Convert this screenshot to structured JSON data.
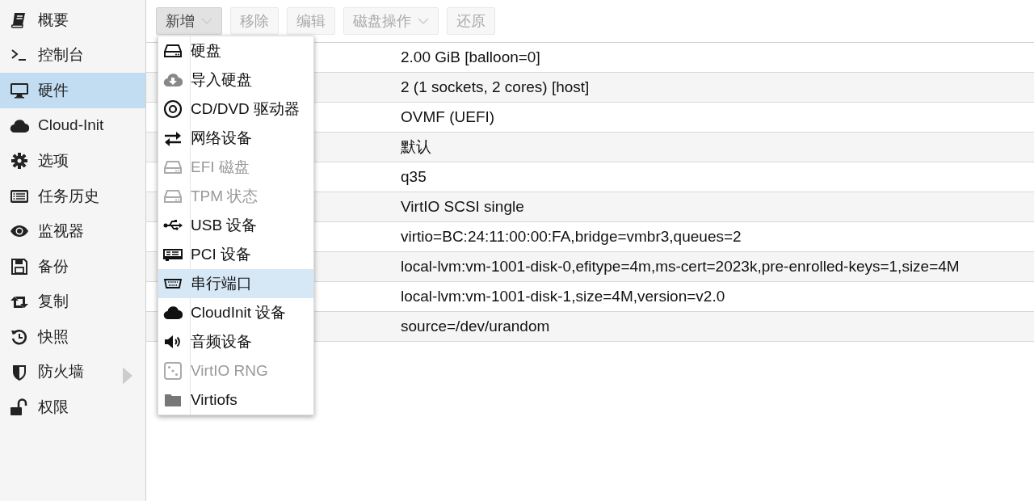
{
  "sidebar": {
    "items": [
      {
        "label": "概要",
        "kind": "book",
        "selected": false,
        "has_submenu": false
      },
      {
        "label": "控制台",
        "kind": "terminal",
        "selected": false,
        "has_submenu": false
      },
      {
        "label": "硬件",
        "kind": "monitor",
        "selected": true,
        "has_submenu": false
      },
      {
        "label": "Cloud-Init",
        "kind": "cloud",
        "selected": false,
        "has_submenu": false
      },
      {
        "label": "选项",
        "kind": "gear",
        "selected": false,
        "has_submenu": false
      },
      {
        "label": "任务历史",
        "kind": "list",
        "selected": false,
        "has_submenu": false
      },
      {
        "label": "监视器",
        "kind": "eye",
        "selected": false,
        "has_submenu": false
      },
      {
        "label": "备份",
        "kind": "floppy",
        "selected": false,
        "has_submenu": false
      },
      {
        "label": "复制",
        "kind": "retweet",
        "selected": false,
        "has_submenu": false
      },
      {
        "label": "快照",
        "kind": "history",
        "selected": false,
        "has_submenu": false
      },
      {
        "label": "防火墙",
        "kind": "shield",
        "selected": false,
        "has_submenu": true
      },
      {
        "label": "权限",
        "kind": "unlock",
        "selected": false,
        "has_submenu": false
      }
    ]
  },
  "toolbar": {
    "buttons": [
      {
        "label": "新增",
        "disabled": false,
        "pressed": true,
        "dropdown": true
      },
      {
        "label": "移除",
        "disabled": true,
        "pressed": false,
        "dropdown": false
      },
      {
        "label": "编辑",
        "disabled": true,
        "pressed": false,
        "dropdown": false
      },
      {
        "label": "磁盘操作",
        "disabled": true,
        "pressed": false,
        "dropdown": true
      },
      {
        "label": "还原",
        "disabled": true,
        "pressed": false,
        "dropdown": false
      }
    ]
  },
  "add_menu": {
    "items": [
      {
        "label": "硬盘",
        "kind": "hdd",
        "disabled": false,
        "selected": false
      },
      {
        "label": "导入硬盘",
        "kind": "cloud-download",
        "disabled": false,
        "selected": false
      },
      {
        "label": "CD/DVD 驱动器",
        "kind": "disc",
        "disabled": false,
        "selected": false
      },
      {
        "label": "网络设备",
        "kind": "exchange",
        "disabled": false,
        "selected": false
      },
      {
        "label": "EFI 磁盘",
        "kind": "hdd",
        "disabled": true,
        "selected": false
      },
      {
        "label": "TPM 状态",
        "kind": "hdd",
        "disabled": true,
        "selected": false
      },
      {
        "label": "USB 设备",
        "kind": "usb",
        "disabled": false,
        "selected": false
      },
      {
        "label": "PCI 设备",
        "kind": "pci",
        "disabled": false,
        "selected": false
      },
      {
        "label": "串行端口",
        "kind": "serial",
        "disabled": false,
        "selected": true
      },
      {
        "label": "CloudInit 设备",
        "kind": "cloud",
        "disabled": false,
        "selected": false
      },
      {
        "label": "音频设备",
        "kind": "volume",
        "disabled": false,
        "selected": false
      },
      {
        "label": "VirtIO RNG",
        "kind": "dice",
        "disabled": true,
        "selected": false
      },
      {
        "label": "Virtiofs",
        "kind": "folder",
        "disabled": false,
        "selected": false
      }
    ]
  },
  "hardware_table": {
    "rows": [
      {
        "value": "2.00 GiB [balloon=0]"
      },
      {
        "value": "2 (1 sockets, 2 cores) [host]"
      },
      {
        "value": "OVMF (UEFI)"
      },
      {
        "value": "默认"
      },
      {
        "value": "q35"
      },
      {
        "value": "VirtIO SCSI single"
      },
      {
        "value": "virtio=BC:24:11:00:00:FA,bridge=vmbr3,queues=2"
      },
      {
        "value": "local-lvm:vm-1001-disk-0,efitype=4m,ms-cert=2023k,pre-enrolled-keys=1,size=4M"
      },
      {
        "value": "local-lvm:vm-1001-disk-1,size=4M,version=v2.0"
      },
      {
        "value": "source=/dev/urandom"
      }
    ]
  }
}
